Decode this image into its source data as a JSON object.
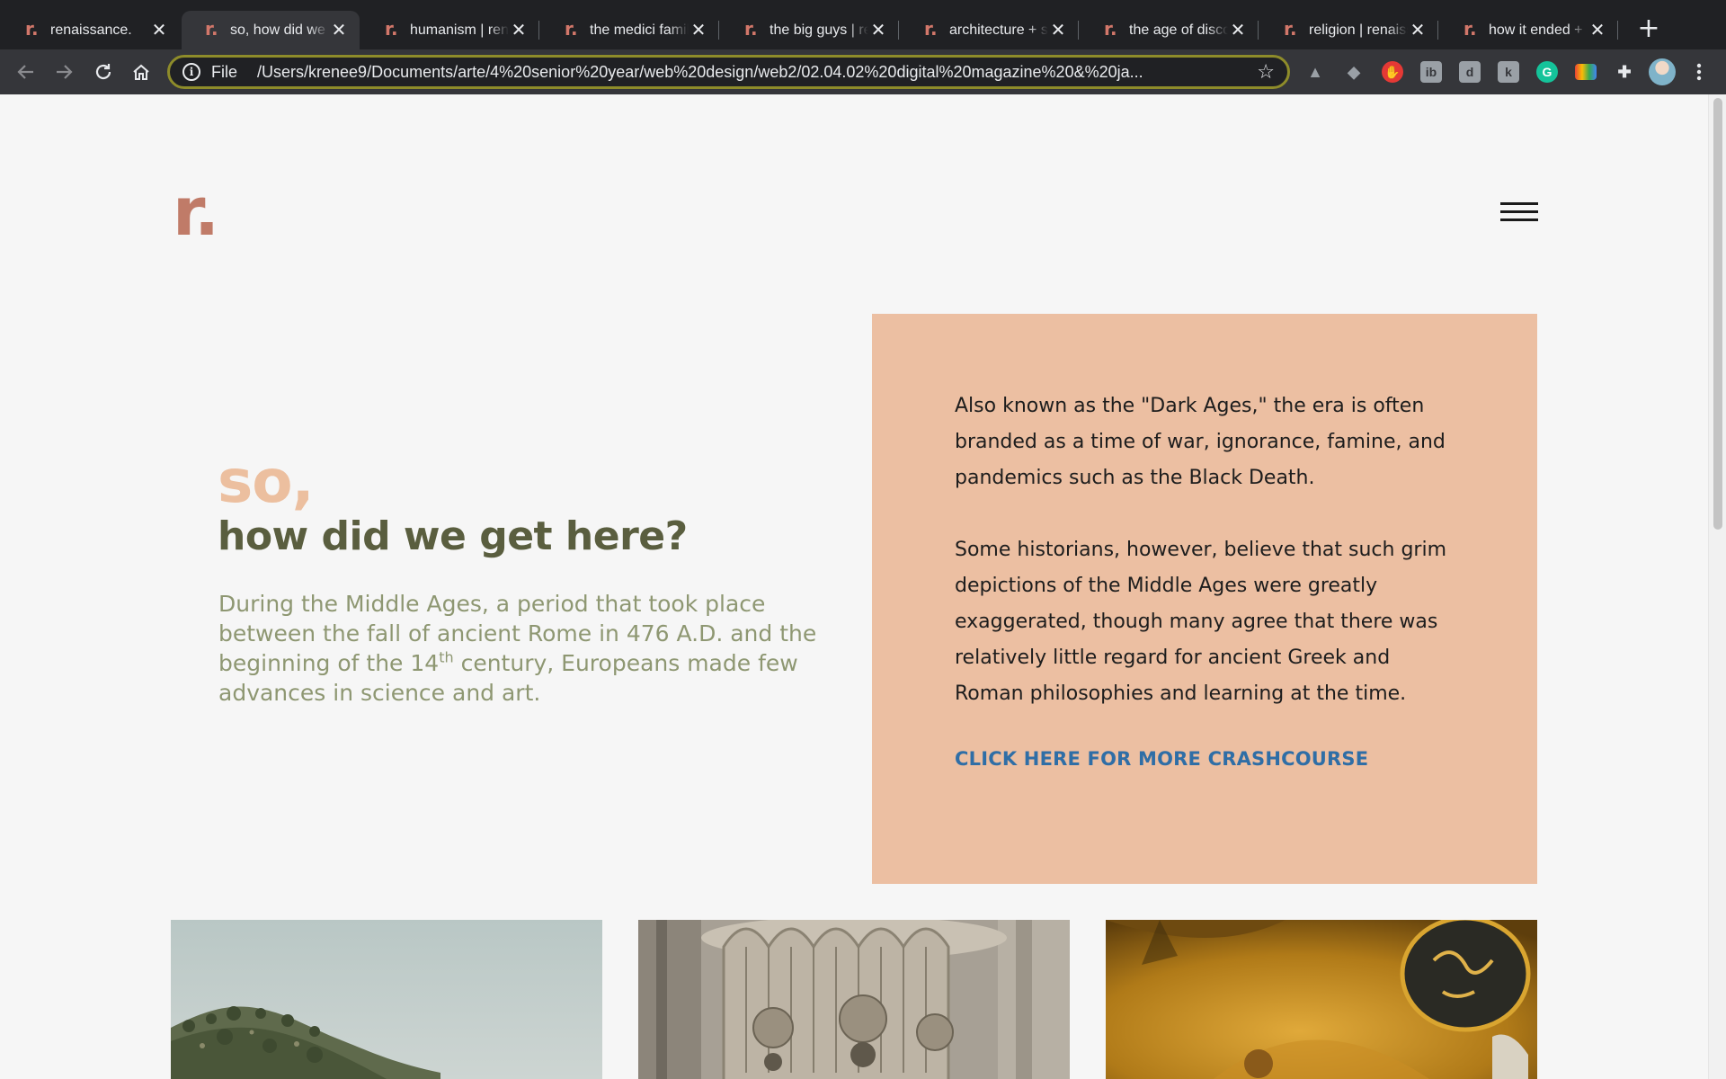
{
  "browser": {
    "tabs": [
      {
        "favicon": "r.",
        "title": "renaissance.",
        "active": false
      },
      {
        "favicon": "r.",
        "title": "so, how did we get here?",
        "active": true
      },
      {
        "favicon": "r.",
        "title": "humanism | renaissance",
        "active": false
      },
      {
        "favicon": "r.",
        "title": "the medici family",
        "active": false
      },
      {
        "favicon": "r.",
        "title": "the big guys | renaissance",
        "active": false
      },
      {
        "favicon": "r.",
        "title": "architecture + science",
        "active": false
      },
      {
        "favicon": "r.",
        "title": "the age of discovery",
        "active": false
      },
      {
        "favicon": "r.",
        "title": "religion | renaissance",
        "active": false
      },
      {
        "favicon": "r.",
        "title": "how it ended + after",
        "active": false
      }
    ],
    "close_glyph": "✕",
    "new_tab_glyph": "+",
    "omnibox": {
      "scheme": "File",
      "url": "/Users/krenee9/Documents/arte/4%20senior%20year/web%20design/web2/02.04.02%20digital%20magazine%20&%20ja..."
    },
    "extensions": [
      {
        "name": "google-drive-icon",
        "glyph": "▲",
        "color": "#9aa0a6"
      },
      {
        "name": "dropbox-icon",
        "glyph": "◆",
        "color": "#9aa0a6"
      },
      {
        "name": "adblock-icon",
        "glyph": "✋",
        "color": "#e53935"
      },
      {
        "name": "ib-extension-icon",
        "glyph": "ib",
        "color": "#9aa0a6"
      },
      {
        "name": "d-extension-icon",
        "glyph": "d",
        "color": "#9aa0a6"
      },
      {
        "name": "k-extension-icon",
        "glyph": "k",
        "color": "#9aa0a6"
      },
      {
        "name": "grammarly-icon",
        "glyph": "G",
        "color": "#15c39a"
      },
      {
        "name": "color-picker-icon",
        "glyph": "▬",
        "color": "#f4b400"
      },
      {
        "name": "extensions-puzzle-icon",
        "glyph": "✚",
        "color": "#35363a"
      }
    ],
    "colors": {
      "tabbar": "#202124",
      "toolbar": "#35363a",
      "omnibox_focus": "#8e8c2a"
    }
  },
  "site": {
    "logo": "r.",
    "hero": {
      "eyebrow": "so,",
      "title": "how did we get here?",
      "lead_before": "During the Middle Ages, a period that took place between the fall of ancient Rome in 476 A.D. and the beginning of the 14",
      "lead_sup": "th",
      "lead_after": " century, Europeans made few advances in science and art."
    },
    "card": {
      "para1": "Also known as the \"Dark Ages,\" the era is often branded as a time of war, ignorance, famine, and pandemics such as the Black Death.",
      "para2": "Some historians, however, believe that such grim depictions of the Middle Ages were greatly exaggerated, though many agree that there was relatively little regard for ancient Greek and Roman philosophies and learning at the time.",
      "cta": "CLICK HERE FOR MORE CRASHCOURSE"
    },
    "colors": {
      "logo": "#c07b68",
      "eyebrow": "#ecbf9f",
      "title": "#5a5e3f",
      "lead": "#8e9772",
      "card_bg": "#ecbfa2",
      "cta": "#2f6ea6"
    }
  }
}
